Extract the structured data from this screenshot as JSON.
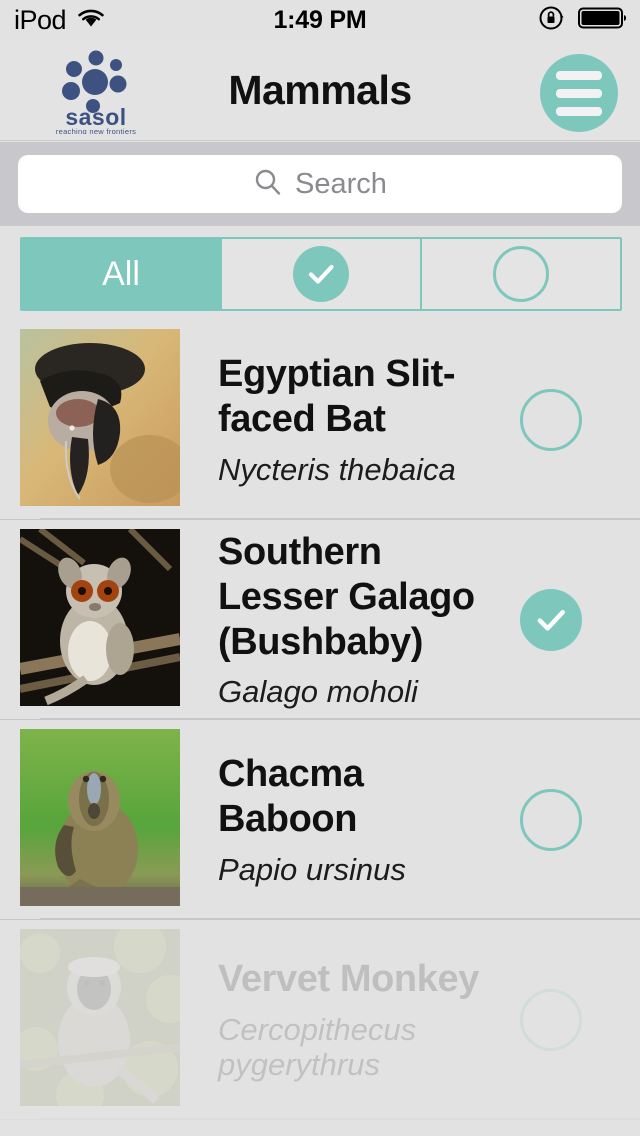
{
  "status_bar": {
    "carrier": "iPod",
    "wifi_icon": "wifi-icon",
    "time": "1:49 PM",
    "rotation_lock_icon": "rotation-lock-icon",
    "battery_icon": "battery-full-icon"
  },
  "nav": {
    "logo_name": "sasol",
    "logo_tagline": "reaching new frontiers",
    "title": "Mammals",
    "menu_icon": "hamburger-menu-icon"
  },
  "search": {
    "placeholder": "Search",
    "value": "",
    "icon": "search-icon"
  },
  "segments": {
    "items": [
      {
        "label": "All",
        "icon": "",
        "active": true
      },
      {
        "label": "",
        "icon": "check-circle-filled-icon",
        "active": false
      },
      {
        "label": "",
        "icon": "circle-outline-icon",
        "active": false
      }
    ]
  },
  "colors": {
    "accent_teal": "#7ec7bc",
    "page_background": "#e2e2e2",
    "search_background": "#c8c7cc",
    "logo_blue": "#3e5282"
  },
  "list": {
    "rows": [
      {
        "common_name": "Egyptian Slit-faced Bat",
        "scientific_name": "Nycteris thebaica",
        "seen": false,
        "toggle_icon": "circle-outline-icon",
        "thumb_name": "egyptian-slit-faced-bat-photo",
        "faded": false
      },
      {
        "common_name": "Southern Lesser Galago (Bushbaby)",
        "scientific_name": "Galago moholi",
        "seen": true,
        "toggle_icon": "check-circle-filled-icon",
        "thumb_name": "southern-lesser-galago-photo",
        "faded": false
      },
      {
        "common_name": "Chacma Baboon",
        "scientific_name": "Papio ursinus",
        "seen": false,
        "toggle_icon": "circle-outline-icon",
        "thumb_name": "chacma-baboon-photo",
        "faded": false
      },
      {
        "common_name": "Vervet Monkey",
        "scientific_name": "Cercopithecus pygerythrus",
        "seen": false,
        "toggle_icon": "circle-outline-icon",
        "thumb_name": "vervet-monkey-photo",
        "faded": true
      }
    ]
  }
}
